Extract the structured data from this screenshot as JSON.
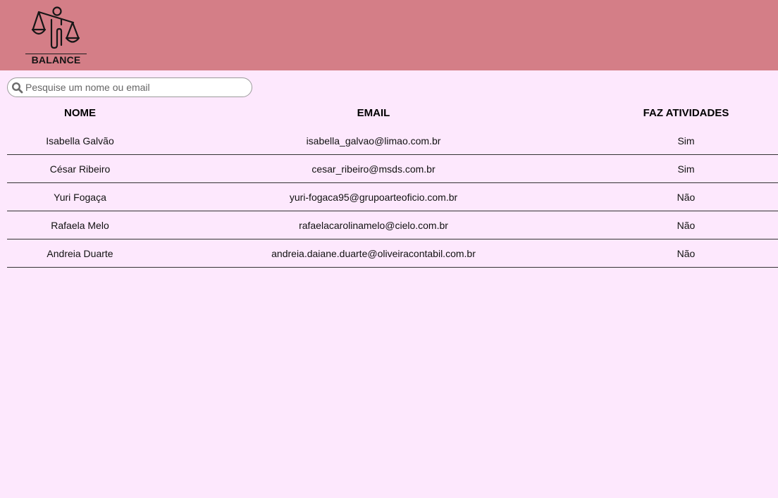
{
  "header": {
    "brand": "BALANCE",
    "logo_icon": "balance-scale-person-icon",
    "background_color": "#d47e87"
  },
  "search": {
    "placeholder": "Pesquise um nome ou email",
    "value": "",
    "icon": "search-icon"
  },
  "table": {
    "columns": [
      "NOME",
      "EMAIL",
      "FAZ ATIVIDADES"
    ],
    "rows": [
      {
        "name": "Isabella Galvão",
        "email": "isabella_galvao@limao.com.br",
        "activities": "Sim"
      },
      {
        "name": "César Ribeiro",
        "email": "cesar_ribeiro@msds.com.br",
        "activities": "Sim"
      },
      {
        "name": "Yuri Fogaça",
        "email": "yuri-fogaca95@grupoarteoficio.com.br",
        "activities": "Não"
      },
      {
        "name": "Rafaela Melo",
        "email": "rafaelacarolinamelo@cielo.com.br",
        "activities": "Não"
      },
      {
        "name": "Andreia Duarte",
        "email": "andreia.daiane.duarte@oliveiracontabil.com.br",
        "activities": "Não"
      }
    ]
  },
  "colors": {
    "page_background": "#fde8fd",
    "row_divider": "#333333"
  }
}
